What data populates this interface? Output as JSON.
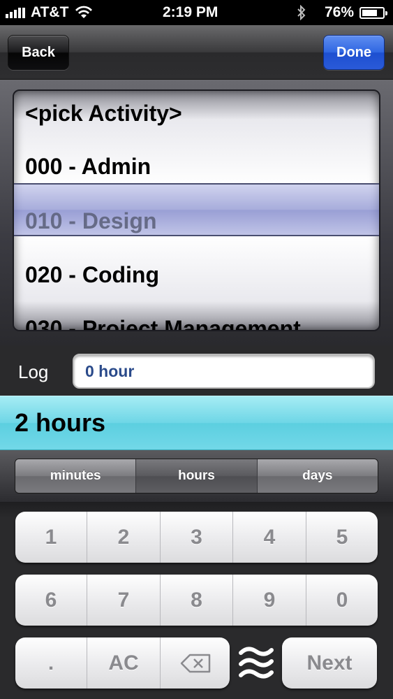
{
  "status_bar": {
    "carrier": "AT&T",
    "time": "2:19 PM",
    "battery": "76%",
    "battery_level": 0.76
  },
  "nav": {
    "back_label": "Back",
    "done_label": "Done",
    "done_color": "#2f66e2"
  },
  "picker": {
    "items": [
      {
        "label": "<pick Activity>"
      },
      {
        "label": "000 - Admin"
      },
      {
        "label": "010 - Design"
      },
      {
        "label": "020 - Coding"
      },
      {
        "label": "030 - Project Management"
      }
    ],
    "selected": "010 - Design"
  },
  "log": {
    "label": "Log",
    "value": "0 hour"
  },
  "hours_display": "2 hours",
  "units": {
    "items": [
      {
        "label": "minutes"
      },
      {
        "label": "hours"
      },
      {
        "label": "days"
      }
    ],
    "selected": "hours"
  },
  "keypad": {
    "row1": [
      "1",
      "2",
      "3",
      "4",
      "5"
    ],
    "row2": [
      "6",
      "7",
      "8",
      "9",
      "0"
    ],
    "dot": ".",
    "clear": "AC",
    "backspace_icon": "backspace-icon",
    "hide_icon": "wave-icon",
    "next_label": "Next"
  }
}
